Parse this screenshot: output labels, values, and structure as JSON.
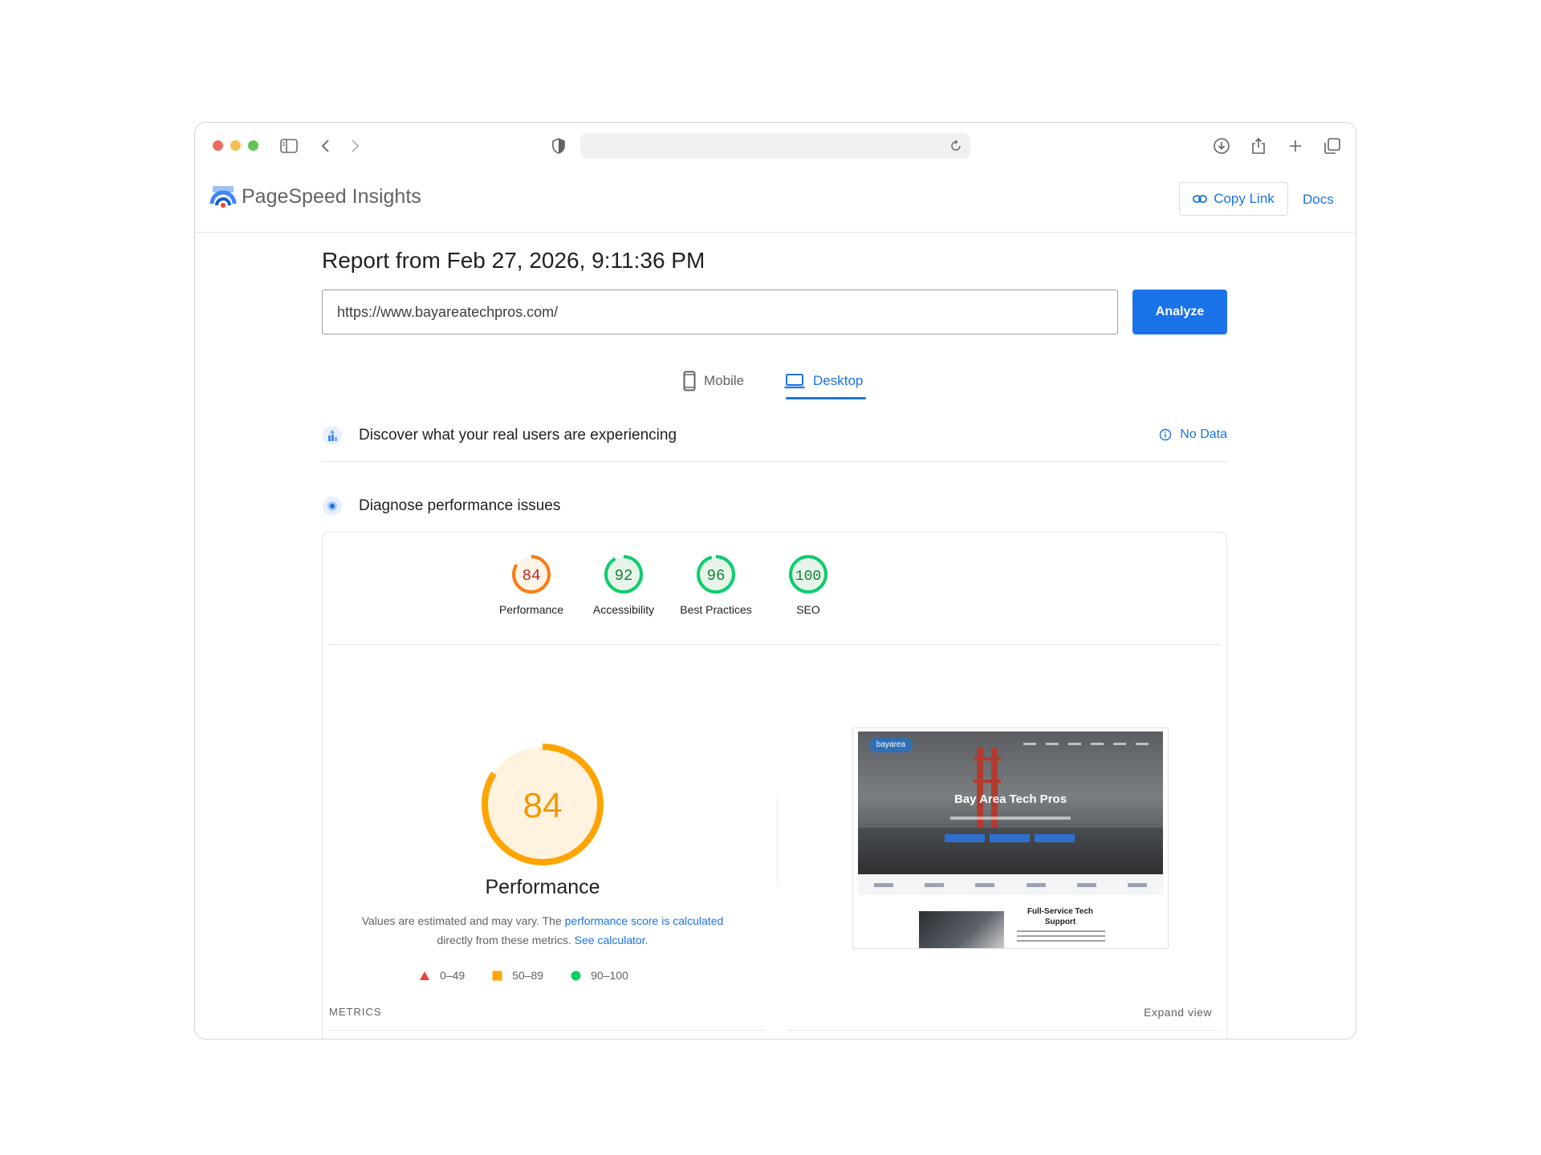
{
  "browser": {
    "icons": [
      "sidebar-icon",
      "back-icon",
      "forward-icon",
      "shield-icon",
      "reload-icon",
      "download-icon",
      "share-icon",
      "plus-icon",
      "tabs-icon"
    ]
  },
  "header": {
    "title": "PageSpeed Insights",
    "copy_link": "Copy Link",
    "docs": "Docs"
  },
  "report": {
    "title": "Report from Feb 27, 2026, 9:11:36 PM",
    "url": "https://www.bayareatechpros.com/",
    "analyze": "Analyze"
  },
  "tabs": {
    "mobile": "Mobile",
    "desktop": "Desktop",
    "active": "desktop"
  },
  "sections": {
    "real_users": "Discover what your real users are experiencing",
    "no_data": "No Data",
    "diagnose": "Diagnose performance issues"
  },
  "scores": [
    {
      "label": "Performance",
      "value": 84,
      "display": "84",
      "color": "#fa7b17",
      "text_color": "#c5221f",
      "bg": "#fff4e5"
    },
    {
      "label": "Accessibility",
      "value": 92,
      "display": "92",
      "color": "#0cce6b",
      "text_color": "#188038",
      "bg": "#e6f4ea"
    },
    {
      "label": "Best Practices",
      "value": 96,
      "display": "96",
      "color": "#0cce6b",
      "text_color": "#188038",
      "bg": "#e6f4ea"
    },
    {
      "label": "SEO",
      "value": 100,
      "display": "100",
      "color": "#0cce6b",
      "text_color": "#188038",
      "bg": "#e6f4ea"
    }
  ],
  "performance": {
    "score": 84,
    "score_display": "84",
    "heading": "Performance",
    "desc_1": "Values are estimated and may vary. The ",
    "desc_link_1": "performance score is calculated",
    "desc_2": " directly from these metrics. ",
    "desc_link_2": "See calculator.",
    "gauge_color": "#ffa400",
    "gauge_bg": "#fff3e0",
    "gauge_text": "#f29900"
  },
  "legend": [
    {
      "range": "0–49",
      "shape": "triangle",
      "color": "#ea4335"
    },
    {
      "range": "50–89",
      "shape": "square",
      "color": "#ffa400"
    },
    {
      "range": "90–100",
      "shape": "circle",
      "color": "#0cce6b"
    }
  ],
  "metrics": {
    "label": "METRICS",
    "expand": "Expand view"
  },
  "thumbnail": {
    "logo": "bayarea",
    "hero_title": "Bay Area Tech Pros",
    "section_heading": "Full-Service Tech Support"
  },
  "colors": {
    "accent": "#1a73e8",
    "dot_red": "#ec6a5e",
    "dot_yellow": "#f4bf4f",
    "dot_green": "#61c554"
  }
}
